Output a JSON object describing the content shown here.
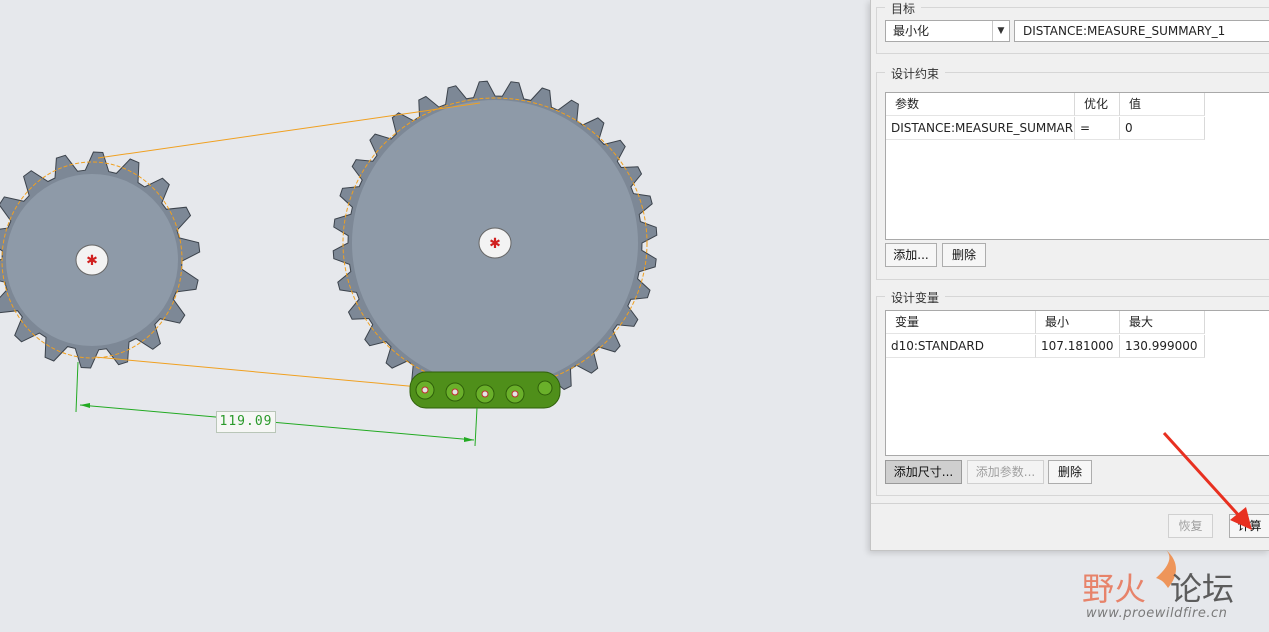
{
  "viewport": {
    "dimension_value": "119.09",
    "colors": {
      "gear": "#8e9aa8",
      "chain": "#5a9a20",
      "constraint_line": "#f0a020",
      "dimension": "#22aa22"
    }
  },
  "dialog": {
    "target": {
      "title": "目标",
      "goal_select": "最小化",
      "measure_field": "DISTANCE:MEASURE_SUMMARY_1"
    },
    "constraints": {
      "title": "设计约束",
      "columns": [
        "参数",
        "优化",
        "值"
      ],
      "rows": [
        {
          "param": "DISTANCE:MEASURE_SUMMAR",
          "op": "=",
          "value": "0"
        }
      ],
      "add_button": "添加...",
      "delete_button": "删除"
    },
    "variables": {
      "title": "设计变量",
      "columns": [
        "变量",
        "最小",
        "最大"
      ],
      "rows": [
        {
          "var": "d10:STANDARD",
          "min": "107.181000",
          "max": "130.999000"
        }
      ],
      "add_dim_button": "添加尺寸...",
      "add_param_button": "添加参数...",
      "delete_button": "删除"
    },
    "footer": {
      "restore_button": "恢复",
      "compute_button": "计算"
    }
  },
  "watermark": {
    "logo_text": "野火论坛",
    "url": "www.proewildfire.cn"
  }
}
